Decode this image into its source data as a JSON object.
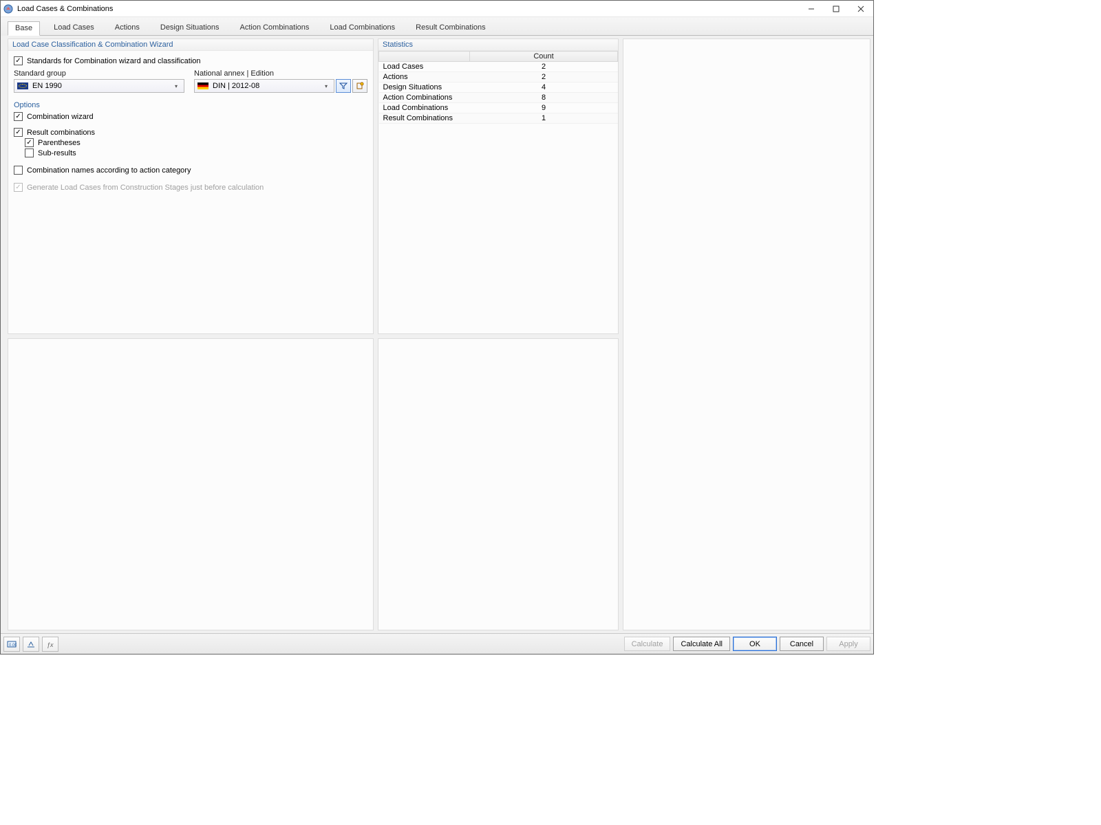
{
  "window": {
    "title": "Load Cases & Combinations"
  },
  "tabs": [
    {
      "label": "Base",
      "active": true
    },
    {
      "label": "Load Cases",
      "active": false
    },
    {
      "label": "Actions",
      "active": false
    },
    {
      "label": "Design Situations",
      "active": false
    },
    {
      "label": "Action Combinations",
      "active": false
    },
    {
      "label": "Load Combinations",
      "active": false
    },
    {
      "label": "Result Combinations",
      "active": false
    }
  ],
  "wizard": {
    "header": "Load Case Classification & Combination Wizard",
    "standards_ck": {
      "label": "Standards for Combination wizard and classification",
      "checked": true
    },
    "std_group_label": "Standard group",
    "std_group_value": "EN 1990",
    "annex_label": "National annex | Edition",
    "annex_value": "DIN | 2012-08",
    "options_header": "Options",
    "opts": {
      "combo_wizard": {
        "label": "Combination wizard",
        "checked": true
      },
      "result_combos": {
        "label": "Result combinations",
        "checked": true
      },
      "parentheses": {
        "label": "Parentheses",
        "checked": true
      },
      "sub_results": {
        "label": "Sub-results",
        "checked": false
      },
      "combo_names": {
        "label": "Combination names according to action category",
        "checked": false
      },
      "generate_lc": {
        "label": "Generate Load Cases from Construction Stages just before calculation",
        "checked": true,
        "disabled": true
      }
    }
  },
  "stats": {
    "header": "Statistics",
    "columns": {
      "name": "",
      "count": "Count"
    },
    "rows": [
      {
        "name": "Load Cases",
        "count": "2"
      },
      {
        "name": "Actions",
        "count": "2"
      },
      {
        "name": "Design Situations",
        "count": "4"
      },
      {
        "name": "Action Combinations",
        "count": "8"
      },
      {
        "name": "Load Combinations",
        "count": "9"
      },
      {
        "name": "Result Combinations",
        "count": "1"
      }
    ]
  },
  "footer": {
    "calculate": "Calculate",
    "calculate_all": "Calculate All",
    "ok": "OK",
    "cancel": "Cancel",
    "apply": "Apply"
  }
}
